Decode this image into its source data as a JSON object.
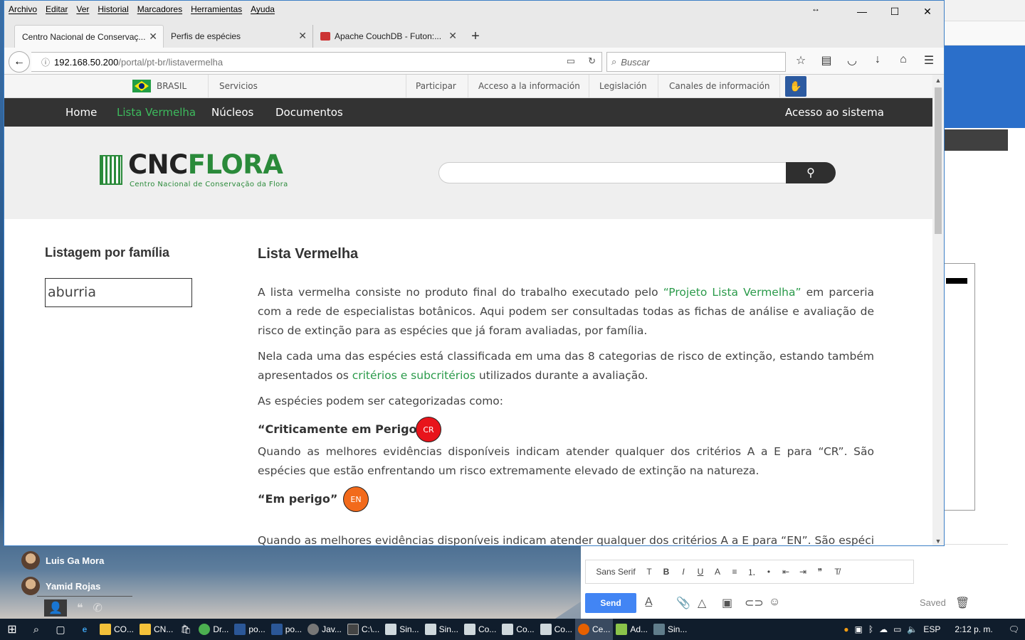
{
  "browser": {
    "menu": [
      "Archivo",
      "Editar",
      "Ver",
      "Historial",
      "Marcadores",
      "Herramientas",
      "Ayuda"
    ],
    "tabs": [
      {
        "title": "Centro Nacional de Conservaç..."
      },
      {
        "title": "Perfis de espécies"
      },
      {
        "title": "Apache CouchDB - Futon:..."
      }
    ],
    "url_host": "192.168.50.200",
    "url_path": "/portal/pt-br/listavermelha",
    "search_placeholder": "Buscar"
  },
  "govbar": {
    "country": "BRASIL",
    "services": "Servicios",
    "links": [
      "Participar",
      "Acceso a la información",
      "Legislación",
      "Canales de información"
    ]
  },
  "nav": {
    "items": [
      "Home",
      "Lista Vermelha",
      "Núcleos",
      "Documentos"
    ],
    "current": "Lista Vermelha",
    "login": "Acesso ao sistema"
  },
  "logo": {
    "part1": "CNC",
    "part2": "FLORA",
    "subtitle": "Centro Nacional de Conservação da Flora"
  },
  "sidebar": {
    "title": "Listagem por família",
    "search_value": "aburria"
  },
  "main": {
    "title": "Lista Vermelha",
    "p1_before": "A lista vermelha consiste no produto final do trabalho executado pelo ",
    "p1_link": "“Projeto Lista Vermelha”",
    "p1_after": " em parceria com a rede de especialistas botânicos. Aqui podem ser consultadas todas as fichas de análise e avaliação de risco de extinção para as espécies que já foram avaliadas, por família.",
    "p2_before": "Nela cada uma das espécies está classificada em uma das 8 categorias de risco de extinção, estando também apresentados os ",
    "p2_link": "critérios e subcritérios",
    "p2_after": " utilizados durante a avaliação.",
    "p3": "As espécies podem ser categorizadas como:",
    "categories": [
      {
        "name": "“Criticamente em Perigo”",
        "code": "CR",
        "color": "#e8141b",
        "desc": "Quando as melhores evidências disponíveis indicam atender qualquer dos critérios A a E para “CR”. São espécies que estão enfrentando um risco extremamente elevado de extinção na natureza."
      },
      {
        "name": "“Em perigo”",
        "code": "EN",
        "color": "#f26a1b",
        "desc": "Quando as melhores evidências disponíveis indicam atender qualquer dos critérios A a E para “EN”. São espécies que"
      }
    ]
  },
  "chat": {
    "contacts": [
      "Luis Ga Mora",
      "Yamid Rojas"
    ],
    "font_label": "Sans Serif",
    "send_label": "Send",
    "saved_label": "Saved"
  },
  "taskbar": {
    "items": [
      "CO...",
      "CN...",
      "Dr...",
      "po...",
      "po...",
      "Jav...",
      "C:\\...",
      "Sin...",
      "Sin...",
      "Co...",
      "Co...",
      "Co...",
      "Ce...",
      "Ad...",
      "Sin..."
    ],
    "lang": "ESP",
    "time": "2:12 p. m."
  }
}
